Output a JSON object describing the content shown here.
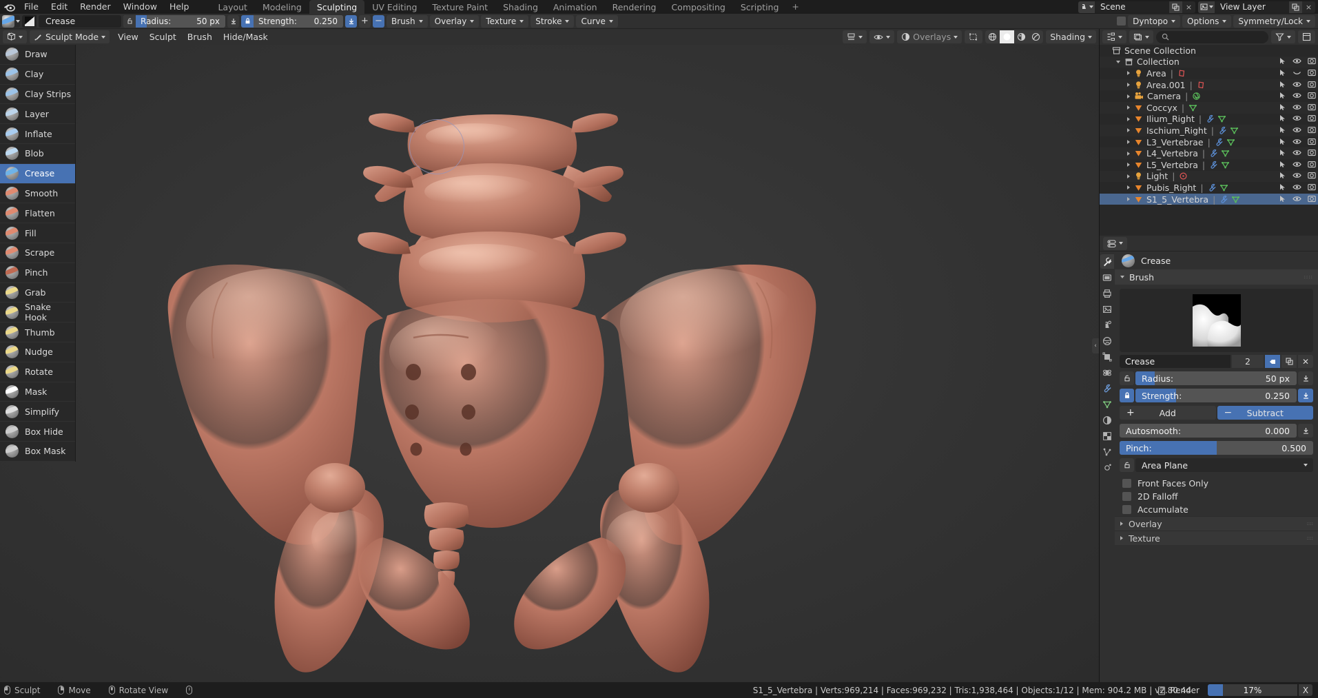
{
  "topbar": {
    "logo": "blender-logo",
    "menus": [
      "File",
      "Edit",
      "Render",
      "Window",
      "Help"
    ],
    "workspace_tabs": [
      {
        "label": "Layout",
        "active": false
      },
      {
        "label": "Modeling",
        "active": false
      },
      {
        "label": "Sculpting",
        "active": true
      },
      {
        "label": "UV Editing",
        "active": false
      },
      {
        "label": "Texture Paint",
        "active": false
      },
      {
        "label": "Shading",
        "active": false
      },
      {
        "label": "Animation",
        "active": false
      },
      {
        "label": "Rendering",
        "active": false
      },
      {
        "label": "Compositing",
        "active": false
      },
      {
        "label": "Scripting",
        "active": false
      }
    ],
    "add_workspace": "+",
    "scene": {
      "name": "Scene",
      "copy": "copy-icon",
      "close": "×"
    },
    "view_layer": {
      "name": "View Layer",
      "copy": "copy-icon",
      "close": "×"
    }
  },
  "tool_settings": {
    "brush_name": "Crease",
    "radius": {
      "label": "Radius:",
      "value": "50 px",
      "fill_pct": 12,
      "locked": false
    },
    "strength": {
      "label": "Strength:",
      "value": "0.250",
      "fill_pct": 0,
      "locked": true
    },
    "add_label": "+",
    "subtract_label": "−",
    "popovers": [
      "Brush",
      "Overlay",
      "Texture",
      "Stroke",
      "Curve"
    ],
    "right_popovers": [
      "Dyntopo",
      "Options",
      "Symmetry/Lock"
    ]
  },
  "viewport_header": {
    "mode": "Sculpt Mode",
    "menus": [
      "View",
      "Sculpt",
      "Brush",
      "Hide/Mask"
    ],
    "overlays_label": "Overlays",
    "shading_label": "Shading",
    "shading_modes": [
      "wireframe",
      "solid",
      "material",
      "rendered"
    ],
    "active_shading": "solid"
  },
  "toolbar": {
    "brushes": [
      {
        "label": "Draw",
        "active": false,
        "color": "#b9c7d8"
      },
      {
        "label": "Clay",
        "active": false,
        "color": "#9cc3e8"
      },
      {
        "label": "Clay Strips",
        "active": false,
        "color": "#9cc3e8"
      },
      {
        "label": "Layer",
        "active": false,
        "color": "#bcd4ea"
      },
      {
        "label": "Inflate",
        "active": false,
        "color": "#a9cdf0"
      },
      {
        "label": "Blob",
        "active": false,
        "color": "#bcd9f2"
      },
      {
        "label": "Crease",
        "active": true,
        "color": "#6fb3e8"
      },
      {
        "label": "Smooth",
        "active": false,
        "color": "#e08a70"
      },
      {
        "label": "Flatten",
        "active": false,
        "color": "#e08a70"
      },
      {
        "label": "Fill",
        "active": false,
        "color": "#e08a70"
      },
      {
        "label": "Scrape",
        "active": false,
        "color": "#e08a70"
      },
      {
        "label": "Pinch",
        "active": false,
        "color": "#c06a52"
      },
      {
        "label": "Grab",
        "active": false,
        "color": "#ecd98a"
      },
      {
        "label": "Snake Hook",
        "active": false,
        "color": "#ecd98a"
      },
      {
        "label": "Thumb",
        "active": false,
        "color": "#ecd98a"
      },
      {
        "label": "Nudge",
        "active": false,
        "color": "#ecd98a"
      },
      {
        "label": "Rotate",
        "active": false,
        "color": "#ecd98a"
      },
      {
        "label": "Mask",
        "active": false,
        "color": "#ffffff"
      },
      {
        "label": "Simplify",
        "active": false,
        "color": "#dddddd"
      },
      {
        "label": "Box Hide",
        "active": false,
        "color": "#cccccc"
      },
      {
        "label": "Box Mask",
        "active": false,
        "color": "#cccccc"
      }
    ]
  },
  "outliner": {
    "display_mode_icon": "outliner-view-layer-icon",
    "filter_icon": "filter-icon",
    "search_placeholder": "",
    "rows": [
      {
        "label": "Scene Collection",
        "indent": 0,
        "icon": "scene-collection-icon",
        "icon_color": "#c0c0c0",
        "disclosure": "none",
        "datatypes": [],
        "has_restrict": false,
        "selected": false
      },
      {
        "label": "Collection",
        "indent": 1,
        "icon": "collection-icon",
        "icon_color": "#c0c0c0",
        "disclosure": "open",
        "datatypes": [],
        "has_restrict": true,
        "selected": false
      },
      {
        "label": "Area",
        "indent": 2,
        "icon": "light-icon",
        "icon_color": "#e8a33d",
        "disclosure": "closed",
        "datatypes": [
          {
            "icon": "light-data-icon",
            "color": "#e05555"
          }
        ],
        "has_restrict": true,
        "selected": false,
        "hidden": true
      },
      {
        "label": "Area.001",
        "indent": 2,
        "icon": "light-icon",
        "icon_color": "#e8a33d",
        "disclosure": "closed",
        "datatypes": [
          {
            "icon": "light-data-icon",
            "color": "#e05555"
          }
        ],
        "has_restrict": true,
        "selected": false
      },
      {
        "label": "Camera",
        "indent": 2,
        "icon": "camera-icon",
        "icon_color": "#e8a33d",
        "disclosure": "closed",
        "datatypes": [
          {
            "icon": "camera-data-icon",
            "color": "#5bbf5b"
          }
        ],
        "has_restrict": true,
        "selected": false
      },
      {
        "label": "Coccyx",
        "indent": 2,
        "icon": "mesh-object-icon",
        "icon_color": "#e8852c",
        "disclosure": "closed",
        "datatypes": [
          {
            "icon": "mesh-data-icon",
            "color": "#5bbf5b"
          }
        ],
        "has_restrict": true,
        "selected": false
      },
      {
        "label": "Ilium_Right",
        "indent": 2,
        "icon": "mesh-object-icon",
        "icon_color": "#e8852c",
        "disclosure": "closed",
        "datatypes": [
          {
            "icon": "modifier-icon",
            "color": "#5c8fd6"
          },
          {
            "icon": "mesh-data-icon",
            "color": "#5bbf5b"
          }
        ],
        "has_restrict": true,
        "selected": false
      },
      {
        "label": "Ischium_Right",
        "indent": 2,
        "icon": "mesh-object-icon",
        "icon_color": "#e8852c",
        "disclosure": "closed",
        "datatypes": [
          {
            "icon": "modifier-icon",
            "color": "#5c8fd6"
          },
          {
            "icon": "mesh-data-icon",
            "color": "#5bbf5b"
          }
        ],
        "has_restrict": true,
        "selected": false
      },
      {
        "label": "L3_Vertebrae",
        "indent": 2,
        "icon": "mesh-object-icon",
        "icon_color": "#e8852c",
        "disclosure": "closed",
        "datatypes": [
          {
            "icon": "modifier-icon",
            "color": "#5c8fd6"
          },
          {
            "icon": "mesh-data-icon",
            "color": "#5bbf5b"
          }
        ],
        "has_restrict": true,
        "selected": false
      },
      {
        "label": "L4_Vertebra",
        "indent": 2,
        "icon": "mesh-object-icon",
        "icon_color": "#e8852c",
        "disclosure": "closed",
        "datatypes": [
          {
            "icon": "modifier-icon",
            "color": "#5c8fd6"
          },
          {
            "icon": "mesh-data-icon",
            "color": "#5bbf5b"
          }
        ],
        "has_restrict": true,
        "selected": false
      },
      {
        "label": "L5_Vertebra",
        "indent": 2,
        "icon": "mesh-object-icon",
        "icon_color": "#e8852c",
        "disclosure": "closed",
        "datatypes": [
          {
            "icon": "modifier-icon",
            "color": "#5c8fd6"
          },
          {
            "icon": "mesh-data-icon",
            "color": "#5bbf5b"
          }
        ],
        "has_restrict": true,
        "selected": false
      },
      {
        "label": "Light",
        "indent": 2,
        "icon": "light-icon",
        "icon_color": "#e8a33d",
        "disclosure": "closed",
        "datatypes": [
          {
            "icon": "point-light-data-icon",
            "color": "#e05555"
          }
        ],
        "has_restrict": true,
        "selected": false
      },
      {
        "label": "Pubis_Right",
        "indent": 2,
        "icon": "mesh-object-icon",
        "icon_color": "#e8852c",
        "disclosure": "closed",
        "datatypes": [
          {
            "icon": "modifier-icon",
            "color": "#5c8fd6"
          },
          {
            "icon": "mesh-data-icon",
            "color": "#5bbf5b"
          }
        ],
        "has_restrict": true,
        "selected": false
      },
      {
        "label": "S1_5_Vertebra",
        "indent": 2,
        "icon": "mesh-object-icon",
        "icon_color": "#e8852c",
        "disclosure": "closed",
        "datatypes": [
          {
            "icon": "modifier-icon",
            "color": "#5c8fd6"
          },
          {
            "icon": "mesh-data-icon",
            "color": "#5bbf5b"
          }
        ],
        "has_restrict": true,
        "selected": true
      }
    ]
  },
  "properties": {
    "active_tab": "tool-tab",
    "tabs": [
      "tool-tab",
      "render-tab",
      "output-tab",
      "view-layer-tab",
      "scene-tab",
      "world-tab",
      "object-tab",
      "physics-tab",
      "modifier-tab",
      "data-tab",
      "material-tab",
      "texture-tab",
      "particles-tab",
      "constraints-tab"
    ],
    "brush_title": "Crease",
    "panel_brush": "Brush",
    "brush_id": {
      "name": "Crease",
      "users": "2"
    },
    "radius": {
      "label": "Radius:",
      "value": "50 px",
      "fill_pct": 12,
      "locked": false
    },
    "strength": {
      "label": "Strength:",
      "value": "0.250",
      "fill_pct": 25,
      "locked": true
    },
    "add": "Add",
    "subtract": "Subtract",
    "autosmooth": {
      "label": "Autosmooth:",
      "value": "0.000",
      "fill_pct": 0
    },
    "pinch": {
      "label": "Pinch:",
      "value": "0.500",
      "fill_pct": 50
    },
    "plane": "Area Plane",
    "checkboxes": [
      {
        "label": "Front Faces Only",
        "checked": false
      },
      {
        "label": "2D Falloff",
        "checked": false
      },
      {
        "label": "Accumulate",
        "checked": false
      }
    ],
    "collapsed_panels": [
      "Overlay",
      "Texture"
    ]
  },
  "statusbar": {
    "keymap": [
      {
        "mouse": "left",
        "label": "Sculpt"
      },
      {
        "mouse": "right",
        "label": "Move"
      },
      {
        "mouse": "middle",
        "label": "Rotate View"
      },
      {
        "mouse": "plain",
        "label": ""
      }
    ],
    "render_label": "Render",
    "progress_pct": "17%",
    "progress_value": 17,
    "cancel": "X",
    "stats": "S1_5_Vertebra | Verts:969,214 | Faces:969,232 | Tris:1,938,464 | Objects:1/12 | Mem: 904.2 MB | v2.80.44"
  },
  "colors": {
    "accent": "#4772b3",
    "panel": "#303030",
    "dark": "#1d1d1d",
    "mesh_orange": "#e8852c",
    "model_color": "#b5705e"
  }
}
